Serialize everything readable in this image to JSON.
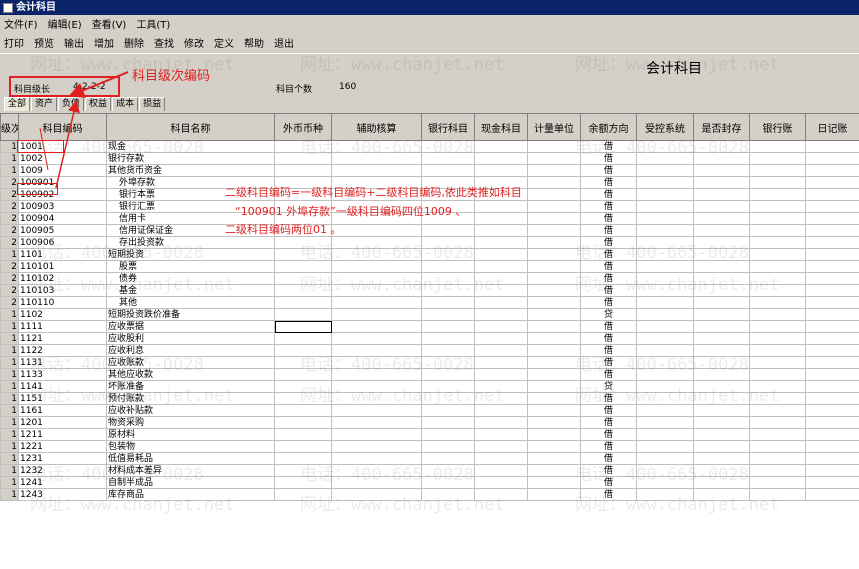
{
  "window": {
    "title": "会计科目"
  },
  "menu": [
    "文件(F)",
    "编辑(E)",
    "查看(V)",
    "工具(T)"
  ],
  "toolbar": [
    "打印",
    "预览",
    "输出",
    "增加",
    "删除",
    "查找",
    "修改",
    "定义",
    "帮助",
    "退出"
  ],
  "info": {
    "page_title": "会计科目",
    "level_label": "科目级长",
    "level_value": "4-2-2-2",
    "count_label": "科目个数",
    "count_value": "160"
  },
  "tabs": [
    "全部",
    "资产",
    "负债",
    "权益",
    "成本",
    "损益"
  ],
  "columns": [
    "级次",
    "科目编码",
    "科目名称",
    "外币币种",
    "辅助核算",
    "银行科目",
    "现金科目",
    "计量单位",
    "余额方向",
    "受控系统",
    "是否封存",
    "银行账",
    "日记账"
  ],
  "rows": [
    {
      "level": "1",
      "code": "1001",
      "name": "现金",
      "dir": "借"
    },
    {
      "level": "1",
      "code": "1002",
      "name": "银行存款",
      "dir": "借"
    },
    {
      "level": "1",
      "code": "1009",
      "name": "其他货币资金",
      "dir": "借"
    },
    {
      "level": "2",
      "code": "100901",
      "name": "外埠存款",
      "dir": "借"
    },
    {
      "level": "2",
      "code": "100902",
      "name": "银行本票",
      "dir": "借"
    },
    {
      "level": "2",
      "code": "100903",
      "name": "银行汇票",
      "dir": "借"
    },
    {
      "level": "2",
      "code": "100904",
      "name": "信用卡",
      "dir": "借"
    },
    {
      "level": "2",
      "code": "100905",
      "name": "信用证保证金",
      "dir": "借"
    },
    {
      "level": "2",
      "code": "100906",
      "name": "存出投资款",
      "dir": "借"
    },
    {
      "level": "1",
      "code": "1101",
      "name": "短期投资",
      "dir": "借"
    },
    {
      "level": "2",
      "code": "110101",
      "name": "股票",
      "dir": "借"
    },
    {
      "level": "2",
      "code": "110102",
      "name": "债券",
      "dir": "借"
    },
    {
      "level": "2",
      "code": "110103",
      "name": "基金",
      "dir": "借"
    },
    {
      "level": "2",
      "code": "110110",
      "name": "其他",
      "dir": "借"
    },
    {
      "level": "1",
      "code": "1102",
      "name": "短期投资跌价准备",
      "dir": "贷"
    },
    {
      "level": "1",
      "code": "1111",
      "name": "应收票据",
      "dir": "借"
    },
    {
      "level": "1",
      "code": "1121",
      "name": "应收股利",
      "dir": "借"
    },
    {
      "level": "1",
      "code": "1122",
      "name": "应收利息",
      "dir": "借"
    },
    {
      "level": "1",
      "code": "1131",
      "name": "应收账款",
      "dir": "借"
    },
    {
      "level": "1",
      "code": "1133",
      "name": "其他应收款",
      "dir": "借"
    },
    {
      "level": "1",
      "code": "1141",
      "name": "坏账准备",
      "dir": "贷"
    },
    {
      "level": "1",
      "code": "1151",
      "name": "预付账款",
      "dir": "借"
    },
    {
      "level": "1",
      "code": "1161",
      "name": "应收补贴款",
      "dir": "借"
    },
    {
      "level": "1",
      "code": "1201",
      "name": "物资采购",
      "dir": "借"
    },
    {
      "level": "1",
      "code": "1211",
      "name": "原材料",
      "dir": "借"
    },
    {
      "level": "1",
      "code": "1221",
      "name": "包装物",
      "dir": "借"
    },
    {
      "level": "1",
      "code": "1231",
      "name": "低值易耗品",
      "dir": "借"
    },
    {
      "level": "1",
      "code": "1232",
      "name": "材料成本差异",
      "dir": "借"
    },
    {
      "level": "1",
      "code": "1241",
      "name": "自制半成品",
      "dir": "借"
    },
    {
      "level": "1",
      "code": "1243",
      "name": "库存商品",
      "dir": "借"
    }
  ],
  "annotations": {
    "label": "科目级次编码",
    "note_line1": "二级科目编码=一级科目编码+二级科目编码,依此类推如科目",
    "note_line2": "“100901  外埠存款”一级科目编码四位1009 、",
    "note_line3": "二级科目编码两位01 。"
  },
  "watermark": {
    "phone": "电话：400-665-0028",
    "site": "网址：www.chanjet.net"
  },
  "colors": {
    "title_bar": "#0a246a",
    "annotation": "#e02020",
    "chrome": "#d4d0c8"
  }
}
